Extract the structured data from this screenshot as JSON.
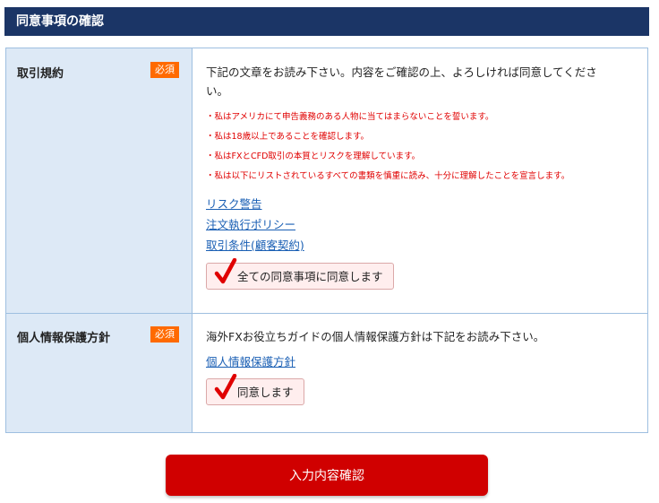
{
  "header": {
    "title": "同意事項の確認"
  },
  "required_badge": "必須",
  "terms": {
    "label": "取引規約",
    "intro": "下記の文章をお読み下さい。内容をご確認の上、よろしければ同意してください。",
    "notes": [
      "・私はアメリカにて申告義務のある人物に当てはまらないことを誓います。",
      "・私は18歳以上であることを確認します。",
      "・私はFXとCFD取引の本質とリスクを理解しています。",
      "・私は以下にリストされているすべての書類を慎重に読み、十分に理解したことを宣言します。"
    ],
    "links": [
      "リスク警告",
      "注文執行ポリシー",
      "取引条件(顧客契約)"
    ],
    "agree_label": "全ての同意事項に同意します",
    "agree_checked": true
  },
  "privacy": {
    "label": "個人情報保護方針",
    "intro": "海外FXお役立ちガイドの個人情報保護方針は下記をお読み下さい。",
    "link": "個人情報保護方針",
    "agree_label": "同意します",
    "agree_checked": true
  },
  "submit_label": "入力内容確認",
  "colors": {
    "header_bg": "#1b3566",
    "label_bg": "#dde9f6",
    "border": "#9ebfe0",
    "badge": "#ff6a00",
    "note_text": "#e00000",
    "link": "#1a5fb4",
    "agree_bg": "#ffeeee",
    "check": "#e00000",
    "submit_bg": "#d00000"
  }
}
